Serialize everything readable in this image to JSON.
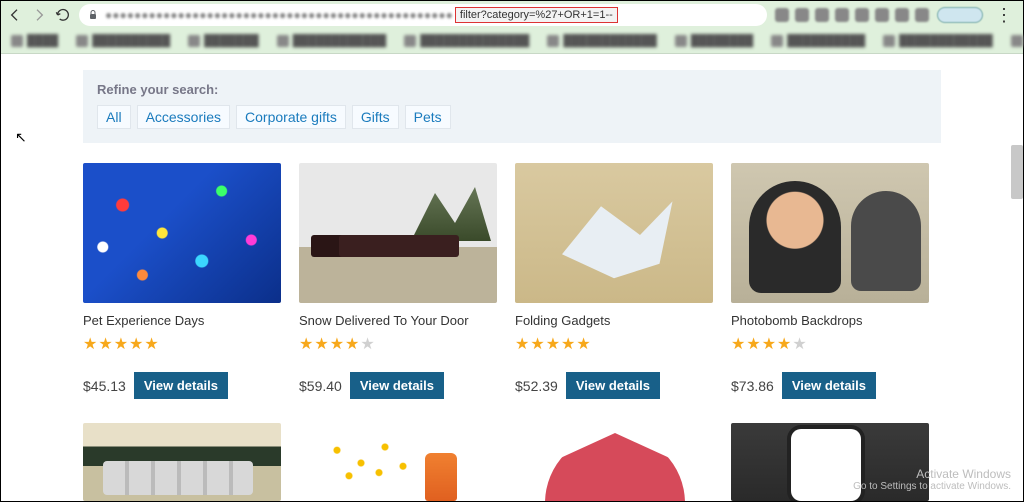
{
  "browser": {
    "url_blurred": "●●●●●●●●●●●●●●●●●●●●●●●●●●●●●●●●●●●●●●●●●●●●●●●●",
    "url_highlight": "filter?category=%27+OR+1=1--"
  },
  "refine": {
    "title": "Refine your search:",
    "links": [
      "All",
      "Accessories",
      "Corporate gifts",
      "Gifts",
      "Pets"
    ]
  },
  "products": [
    {
      "name": "Pet Experience Days",
      "rating": 5,
      "price": "$45.13",
      "button": "View details",
      "img": "img-balloons"
    },
    {
      "name": "Snow Delivered To Your Door",
      "rating": 4,
      "price": "$59.40",
      "button": "View details",
      "img": "img-train"
    },
    {
      "name": "Folding Gadgets",
      "rating": 5,
      "price": "$52.39",
      "button": "View details",
      "img": "img-origami"
    },
    {
      "name": "Photobomb Backdrops",
      "rating": 4,
      "price": "$73.86",
      "button": "View details",
      "img": "img-photobomb"
    }
  ],
  "row2_imgs": [
    "img-cans",
    "img-spray",
    "img-umbrella",
    "img-phone"
  ],
  "watermark": {
    "line1": "Activate Windows",
    "line2": "Go to Settings to activate Windows."
  }
}
